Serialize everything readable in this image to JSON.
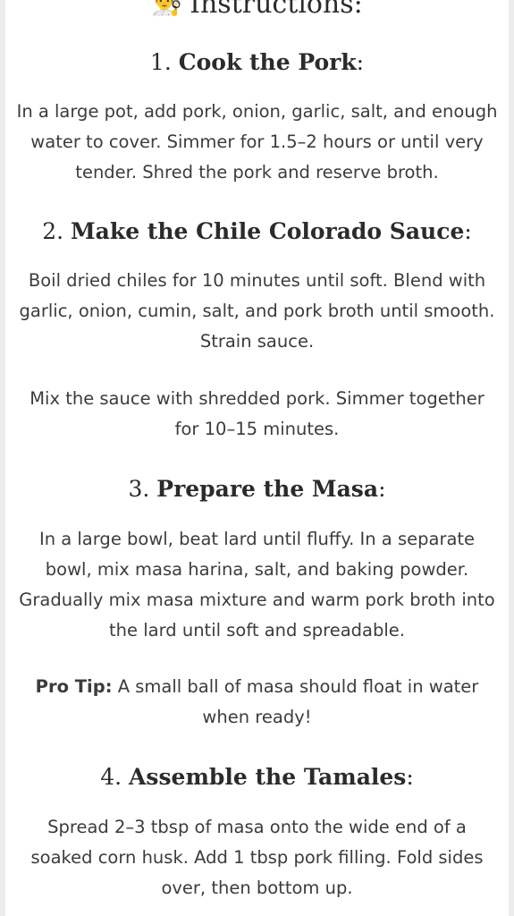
{
  "header": {
    "icon": "chef-icon",
    "title": "Instructions:"
  },
  "steps": [
    {
      "number": "1.",
      "name": "Cook the Pork",
      "paragraphs": [
        [
          "In a large pot, add pork, onion, garlic, salt, and enough",
          "water to cover. Simmer for 1.5–2 hours or until very",
          "tender. Shred the pork and reserve broth."
        ]
      ]
    },
    {
      "number": "2.",
      "name": "Make the Chile Colorado Sauce",
      "paragraphs": [
        [
          "Boil dried chiles for 10 minutes until soft. Blend with",
          "garlic, onion, cumin, salt, and pork broth until smooth.",
          "Strain sauce."
        ],
        [
          "Mix the sauce with shredded pork. Simmer together",
          "for 10–15 minutes."
        ]
      ]
    },
    {
      "number": "3.",
      "name": "Prepare the Masa",
      "paragraphs": [
        [
          "In a large bowl, beat lard until fluffy. In a separate",
          "bowl, mix masa harina, salt, and baking powder.",
          "Gradually mix masa mixture and warm pork broth into",
          "the lard until soft and spreadable."
        ]
      ],
      "tip": {
        "label": "Pro Tip:",
        "lines": [
          " A small ball of masa should float in water",
          "when ready!"
        ]
      }
    },
    {
      "number": "4.",
      "name": "Assemble the Tamales",
      "paragraphs": [
        [
          "Spread 2–3 tbsp of masa onto the wide end of a",
          "soaked corn husk. Add 1 tbsp pork filling. Fold sides",
          "over, then bottom up."
        ]
      ]
    }
  ]
}
